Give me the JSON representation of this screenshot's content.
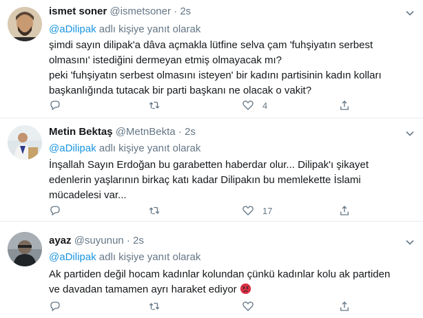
{
  "tweets": [
    {
      "name": "ismet soner",
      "handle": "@ismetsoner",
      "separator": "·",
      "time": "2s",
      "reply_prefix": "",
      "reply_mention": "@aDilipak",
      "reply_suffix": " adlı kişiye yanıt olarak",
      "lines": [
        "şimdi sayın dilipak'a dâva açmakla lütfine selva çam 'fuhşiyatın serbest",
        "olmasını' istediğini dermeyan etmiş olmayacak mı?",
        "peki 'fuhşiyatın serbest olmasını isteyen' bir kadını partisinin kadın kolları",
        "başkanlığında tutacak bir parti başkanı ne olacak o vakit?"
      ],
      "reply_count": "",
      "retweet_count": "",
      "like_count": "4"
    },
    {
      "name": "Metin Bektaş",
      "handle": "@MetnBekta",
      "separator": "·",
      "time": "2s",
      "reply_mention": "@aDilipak",
      "reply_suffix": " adlı kişiye yanıt olarak",
      "lines": [
        "İnşallah Sayın Erdoğan bu garabetten haberdar olur... Dilipak'ı şikayet",
        "edenlerin yaşlarının birkaç katı kadar Dilipakın bu memlekette İslami",
        "mücadelesi var..."
      ],
      "reply_count": "",
      "retweet_count": "",
      "like_count": "17"
    },
    {
      "name": "ayaz",
      "handle": "@suyunun",
      "separator": "·",
      "time": "2s",
      "reply_mention": "@aDilipak",
      "reply_suffix": " adlı kişiye yanıt olarak",
      "lines": [
        "Ak partiden değil hocam kadınlar kolundan çünkü kadınlar kolu ak partiden",
        "ve davadan tamamen ayrı haraket ediyor"
      ],
      "emoji": "angry-face-emoji",
      "reply_count": "",
      "retweet_count": "",
      "like_count": ""
    }
  ],
  "colors": {
    "text": "#14171a",
    "muted": "#657786",
    "link": "#1b95e0",
    "divider": "#e6ecf0"
  },
  "icons": [
    "reply-icon",
    "retweet-icon",
    "like-icon",
    "share-icon",
    "chevron-down-icon"
  ]
}
